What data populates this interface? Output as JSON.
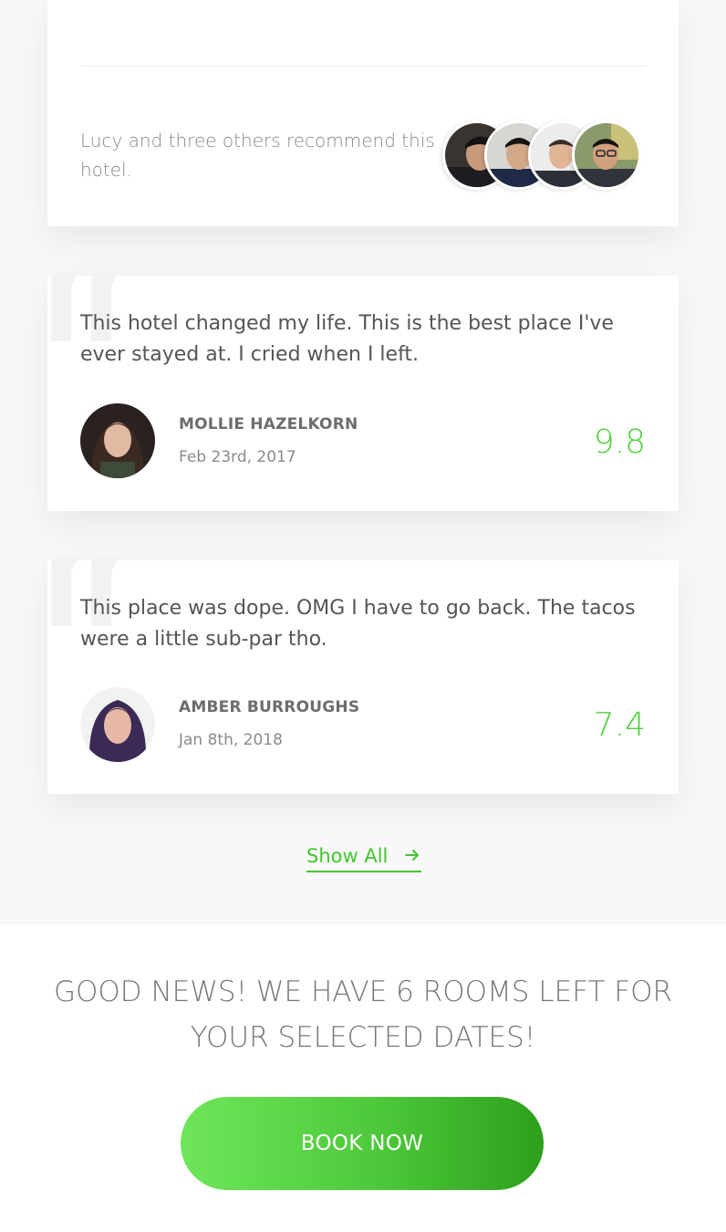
{
  "recommendation": {
    "text": "Lucy and three others recommend this hotel.",
    "avatars": [
      "avatar-recommender-1",
      "avatar-recommender-2",
      "avatar-recommender-3",
      "avatar-recommender-4"
    ]
  },
  "reviews": [
    {
      "text": "This hotel changed my life. This is the best place I've ever stayed at. I cried when I left.",
      "name": "MOLLIE HAZELKORN",
      "date": "Feb 23rd, 2017",
      "score": "9.8"
    },
    {
      "text": "This place was dope. OMG I have to go back. The tacos were a little sub-par tho.",
      "name": "AMBER BURROUGHS",
      "date": "Jan 8th, 2018",
      "score": "7.4"
    }
  ],
  "show_all": {
    "label": "Show All",
    "icon": "arrow-right-icon"
  },
  "availability": {
    "heading": "GOOD NEWS! WE HAVE 6 ROOMS LEFT FOR YOUR SELECTED DATES!",
    "button_label": "BOOK NOW"
  },
  "colors": {
    "accent": "#44c82f",
    "score": "#4fd13a",
    "button_start": "#6fe65a",
    "button_end": "#2c9f1b"
  }
}
